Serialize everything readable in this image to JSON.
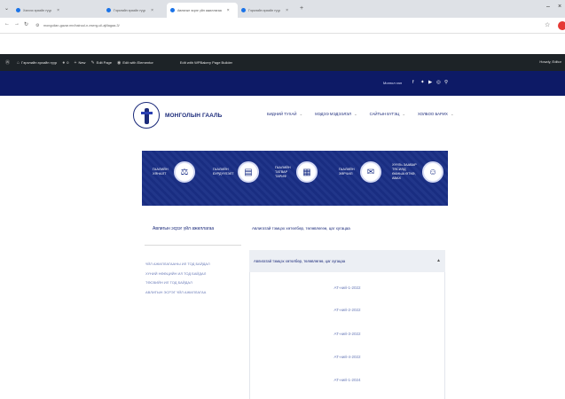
{
  "browser": {
    "tabs": [
      {
        "label": "Хэлхэх эрхийн гүүр"
      },
      {
        "label": "Гэрэлийн эрхийн гүүр"
      },
      {
        "label": "Авлигын эсрэг үйл ажиллагаа"
      },
      {
        "label": "Гэрэлийн эрхийн гүүр"
      }
    ],
    "new_tab": "+",
    "address": "mongolian-gazar.mn/bairuul-n-eserg-uil-ajillagaa-3/",
    "window_controls": {
      "minimize": "–",
      "close": "×"
    }
  },
  "wp_admin_bar": {
    "items": [
      {
        "icon": "wordpress-icon",
        "label": ""
      },
      {
        "icon": "home-icon",
        "label": "Гэрэлийн эрхийн гүүр"
      },
      {
        "icon": "comment-icon",
        "label": "0"
      },
      {
        "icon": "plus-icon",
        "label": "New"
      },
      {
        "icon": "edit-icon",
        "label": "Edit Page"
      },
      {
        "icon": "elementor-icon",
        "label": "Edit with Elementor"
      },
      {
        "icon": "",
        "label": "Edit with WPBakery Page Builder"
      }
    ],
    "howdy": "Howdy, Editor"
  },
  "topbar": {
    "language": "Монгол хэл",
    "social_icons": [
      "facebook-icon",
      "twitter-icon",
      "youtube-icon",
      "instagram-icon",
      "search-icon"
    ]
  },
  "header": {
    "logo_text": "МОНГОЛЫН ГААЛЬ",
    "nav": [
      {
        "label": "БИДНИЙ ТУХАЙ"
      },
      {
        "label": "МЭДЭЭ МЭДЭЭЛЭЛ"
      },
      {
        "label": "САЙТЫН БҮТЭЦ"
      },
      {
        "label": "ХОЛБОО БАРИХ"
      }
    ]
  },
  "banner": {
    "background": "#1a2f86",
    "items": [
      {
        "label": "ГААЛИЙН ХЯНАЛТ",
        "icon": "customs-control-icon"
      },
      {
        "label": "ГААЛИЙН БҮРДҮҮЛЭЛТ",
        "icon": "clearance-icon"
      },
      {
        "label": "ГААЛИЙН ТАТВАР ТАРИФ",
        "icon": "tariff-icon"
      },
      {
        "label": "ГААЛИЙН ЗӨРЧИЛ",
        "icon": "violation-icon"
      },
      {
        "label": "ХҮҮЛЬ ЗААВАР ТЯСИЛД ӨАНЫА ӨТКӨ, АВАХ",
        "icon": "request-icon"
      }
    ]
  },
  "sidebar": {
    "title": "Авлигын эсрэг үйл ажиллагаа",
    "items": [
      {
        "label": "ҮЙЛ АЖИЛЛАГААНЫ ИЛ ТОД БАЙДАЛ"
      },
      {
        "label": "ХҮНИЙ НӨӨЦИЙН ИЛ ТОД БАЙДАЛ"
      },
      {
        "label": "ТӨСВИЙН ИЛ ТОД БАЙДАЛ"
      },
      {
        "label": "АВЛИГЫН ЭСРЭГ ҮЙЛ АЖИЛЛАГАА"
      }
    ]
  },
  "content": {
    "title": "Авлигатай тэмцэх хөтөлбөр, төлөвлөгөө, цаг хугацаа",
    "accordion": {
      "header": "Авлигатай тэмцэх хөтөлбөр, төлөвлөгөө, цаг хугацаа",
      "links": [
        {
          "label": "АТ-ний-1-2022"
        },
        {
          "label": "АТ-ний-2-2022"
        },
        {
          "label": "АТ-ний-3-2022"
        },
        {
          "label": "АТ-ний-4-2022"
        },
        {
          "label": "АТ-ний-1-2024"
        }
      ]
    }
  }
}
